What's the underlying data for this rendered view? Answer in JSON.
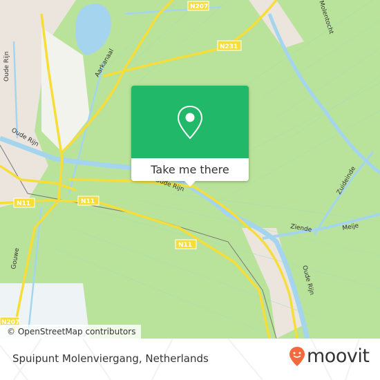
{
  "map": {
    "colors": {
      "land": "#b9e39a",
      "water": "#a5d5ee",
      "road": "#f6dd3a",
      "urban": "#ebe5de",
      "accent": "#21b86a",
      "brand": "#f26a3d"
    },
    "road_shields": [
      "N207",
      "N231",
      "N11",
      "N11",
      "N11",
      "N207"
    ],
    "labels": {
      "oude_rijn_1": "Oude Rijn",
      "oude_rijn_2": "Oude Rijn",
      "oude_rijn_3": "Oude Rijn",
      "oude_rijn_4": "Oude Rijn",
      "aarkanaal": "Aarkanaal",
      "gouwe": "Gouwe",
      "molentocht": "Molentocht",
      "ziende": "Ziende",
      "meije": "Meije",
      "zierikzee": "Zuideinde"
    }
  },
  "popup": {
    "icon": "map-pin-icon",
    "action_label": "Take me there"
  },
  "attribution": "© OpenStreetMap contributors",
  "footer": {
    "place_name": "Spuipunt Molenviergang, Netherlands",
    "logo_text": "moovit"
  }
}
